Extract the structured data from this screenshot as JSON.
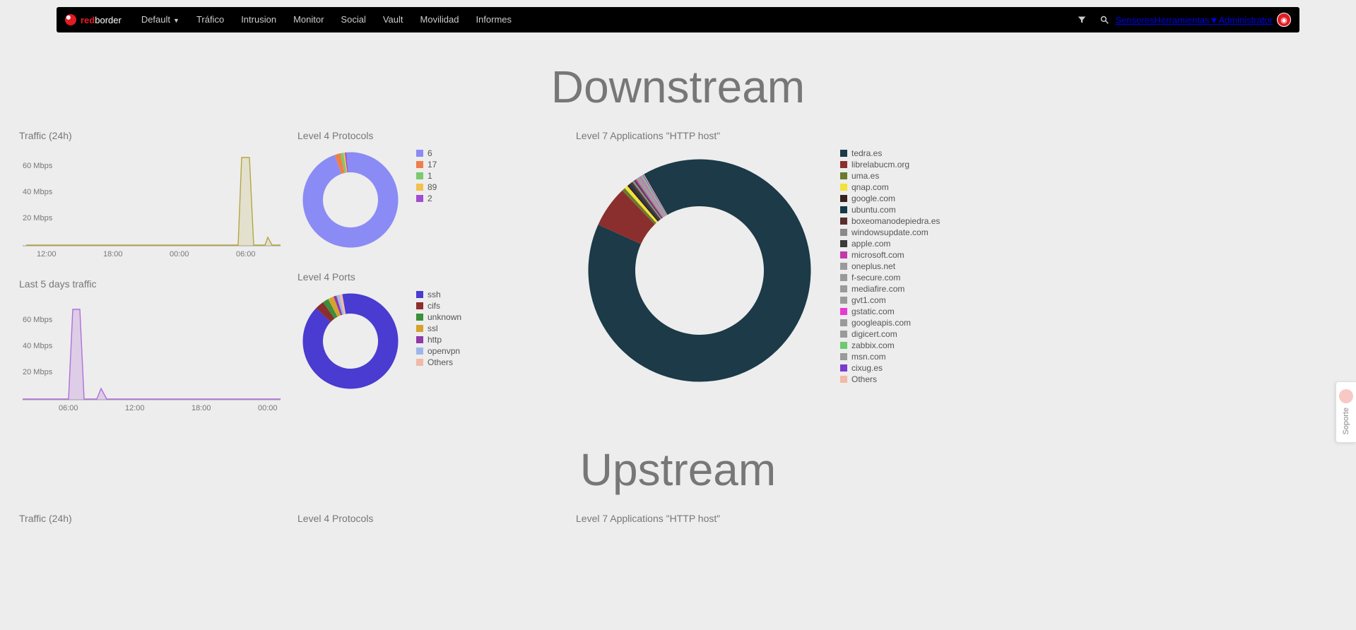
{
  "brand": {
    "red": "red",
    "border": "border"
  },
  "nav": {
    "default": "Default",
    "items": [
      "Tráfico",
      "Intrusion",
      "Monitor",
      "Social",
      "Vault",
      "Movilidad",
      "Informes"
    ],
    "right": {
      "sensores": "Sensores",
      "herramientas": "Herramientas",
      "admin": "Administrator"
    }
  },
  "sections": {
    "downstream_title": "Downstream",
    "upstream_title": "Upstream"
  },
  "panels": {
    "traffic24": "Traffic (24h)",
    "last5": "Last 5 days traffic",
    "l4proto": "Level 4 Protocols",
    "l4ports": "Level 4 Ports",
    "l7apps": "Level 7 Applications \"HTTP host\""
  },
  "support_label": "Soporte",
  "chart_data": {
    "traffic24": {
      "type": "line",
      "x_ticks": [
        "12:00",
        "18:00",
        "00:00",
        "06:00"
      ],
      "ylabel_ticks": [
        "20 Mbps",
        "40 Mbps",
        "60 Mbps"
      ],
      "ylim": [
        0,
        70
      ],
      "series": [
        {
          "name": "traffic",
          "color": "#b5a642",
          "peak_hour": "07:00",
          "peak_value": 65
        }
      ]
    },
    "last5": {
      "type": "line",
      "x_ticks": [
        "06:00",
        "12:00",
        "18:00",
        "00:00"
      ],
      "ylabel_ticks": [
        "20 Mbps",
        "40 Mbps",
        "60 Mbps"
      ],
      "ylim": [
        0,
        70
      ],
      "series": [
        {
          "name": "traffic",
          "color": "#b070d8",
          "peak_hour": "07:00",
          "peak_value": 65,
          "secondary_peak_hour": "09:30",
          "secondary_peak_value": 12
        }
      ]
    },
    "l4_protocols": {
      "type": "donut",
      "series": [
        {
          "name": "6",
          "color": "#8b8bf5",
          "value": 96
        },
        {
          "name": "17",
          "color": "#ef7f4a",
          "value": 2
        },
        {
          "name": "1",
          "color": "#7bc96f",
          "value": 1
        },
        {
          "name": "89",
          "color": "#f2c14e",
          "value": 0.5
        },
        {
          "name": "2",
          "color": "#a24ccf",
          "value": 0.5
        }
      ]
    },
    "l4_ports": {
      "type": "donut",
      "series": [
        {
          "name": "ssh",
          "color": "#4a3bd1",
          "value": 90
        },
        {
          "name": "cifs",
          "color": "#8b2e2e",
          "value": 3
        },
        {
          "name": "unknown",
          "color": "#3a8f3a",
          "value": 2
        },
        {
          "name": "ssl",
          "color": "#d6a22e",
          "value": 2
        },
        {
          "name": "http",
          "color": "#8e3aa8",
          "value": 1
        },
        {
          "name": "openvpn",
          "color": "#9fb7e8",
          "value": 1
        },
        {
          "name": "Others",
          "color": "#f2b9a6",
          "value": 1
        }
      ]
    },
    "l7_apps": {
      "type": "donut",
      "series": [
        {
          "name": "tedra.es",
          "color": "#1c3a47",
          "value": 90
        },
        {
          "name": "librelabucm.org",
          "color": "#8b2e2e",
          "value": 6
        },
        {
          "name": "uma.es",
          "color": "#6b7a2e",
          "value": 0.5
        },
        {
          "name": "qnap.com",
          "color": "#f2e23a",
          "value": 0.5
        },
        {
          "name": "google.com",
          "color": "#3a1f1f",
          "value": 0.3
        },
        {
          "name": "ubuntu.com",
          "color": "#123a47",
          "value": 0.3
        },
        {
          "name": "boxeomanodepiedra.es",
          "color": "#5a2e2e",
          "value": 0.3
        },
        {
          "name": "windowsupdate.com",
          "color": "#8a8a8a",
          "value": 0.3
        },
        {
          "name": "apple.com",
          "color": "#3a3a3a",
          "value": 0.2
        },
        {
          "name": "microsoft.com",
          "color": "#c23aa8",
          "value": 0.2
        },
        {
          "name": "oneplus.net",
          "color": "#9a9a9a",
          "value": 0.2
        },
        {
          "name": "f-secure.com",
          "color": "#9a9a9a",
          "value": 0.2
        },
        {
          "name": "mediafire.com",
          "color": "#9a9a9a",
          "value": 0.1
        },
        {
          "name": "gvt1.com",
          "color": "#9a9a9a",
          "value": 0.1
        },
        {
          "name": "gstatic.com",
          "color": "#e83ad1",
          "value": 0.1
        },
        {
          "name": "googleapis.com",
          "color": "#9a9a9a",
          "value": 0.1
        },
        {
          "name": "digicert.com",
          "color": "#9a9a9a",
          "value": 0.1
        },
        {
          "name": "zabbix.com",
          "color": "#6fc96f",
          "value": 0.1
        },
        {
          "name": "msn.com",
          "color": "#9a9a9a",
          "value": 0.1
        },
        {
          "name": "cixug.es",
          "color": "#7a3acf",
          "value": 0.1
        },
        {
          "name": "Others",
          "color": "#f2b9a6",
          "value": 0.1
        }
      ]
    }
  }
}
